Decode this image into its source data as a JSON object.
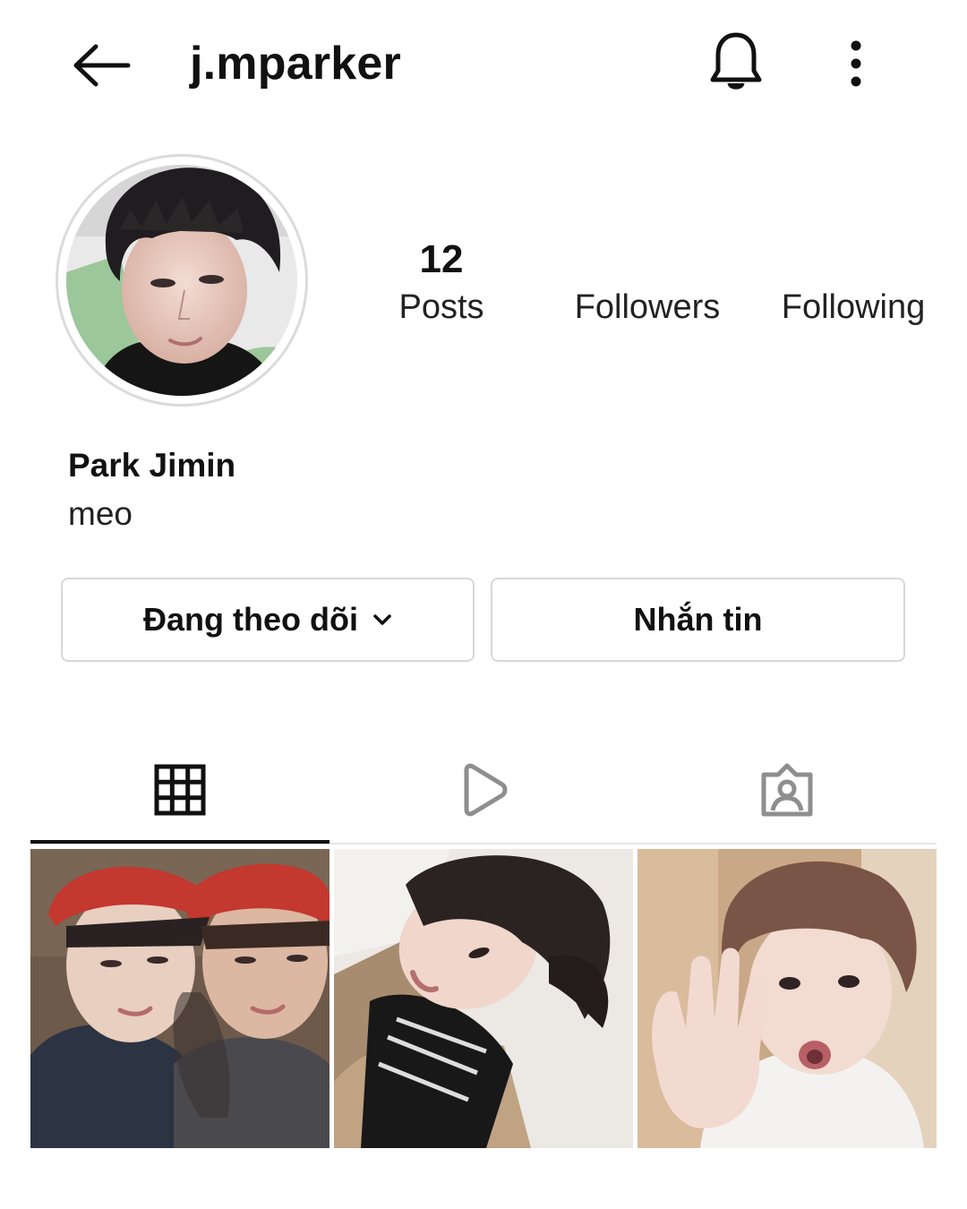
{
  "header": {
    "username": "j.mparker",
    "back_icon": "arrow-left-icon",
    "bell_icon": "bell-icon",
    "more_icon": "more-vertical-icon"
  },
  "profile": {
    "posts_count": "12",
    "posts_label": "Posts",
    "followers_label": "Followers",
    "following_label": "Following",
    "full_name": "Park Jimin",
    "bio": "meo"
  },
  "actions": {
    "follow_label": "Đang theo dõi",
    "message_label": "Nhắn tin"
  },
  "tabs": [
    {
      "name": "posts-grid",
      "icon": "grid-icon",
      "active": true
    },
    {
      "name": "reels",
      "icon": "play-icon",
      "active": false
    },
    {
      "name": "tagged",
      "icon": "tagged-user-icon",
      "active": false
    }
  ],
  "colors": {
    "text": "#111111",
    "border": "#d8d8d8",
    "inactive_icon": "#8e8e8e"
  }
}
